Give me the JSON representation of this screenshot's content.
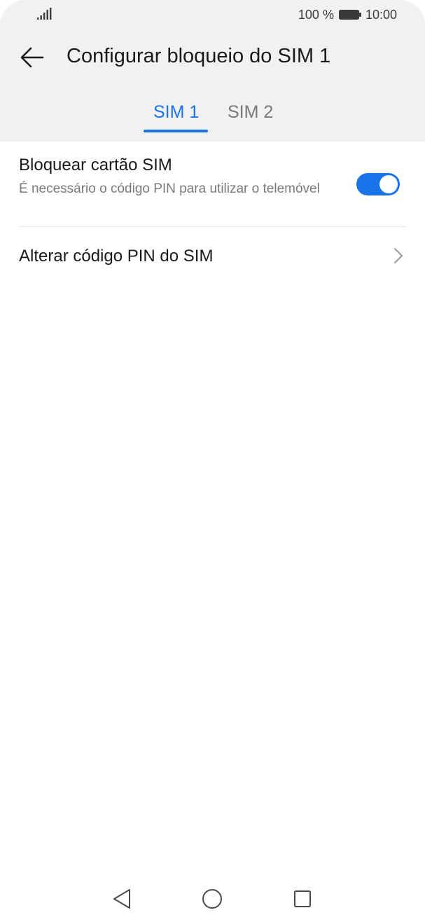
{
  "status_bar": {
    "battery_text": "100 %",
    "time": "10:00"
  },
  "header": {
    "title": "Configurar bloqueio do SIM 1"
  },
  "tabs": [
    {
      "label": "SIM 1",
      "active": true
    },
    {
      "label": "SIM 2",
      "active": false
    }
  ],
  "settings": {
    "lock_sim": {
      "title": "Bloquear cartão SIM",
      "subtitle": "É necessário o código PIN para utilizar o telemóvel",
      "enabled": true
    },
    "change_pin": {
      "label": "Alterar código PIN do SIM"
    }
  },
  "icons": {
    "signal": "signal-icon",
    "battery": "battery-icon",
    "back": "arrow-left-icon",
    "chevron": "chevron-right-icon",
    "nav_back": "triangle-back-icon",
    "nav_home": "circle-home-icon",
    "nav_recent": "square-recent-icon"
  },
  "colors": {
    "accent": "#1a73e8",
    "header_bg": "#f1f1f1",
    "secondary_text": "#7a7a7a"
  }
}
